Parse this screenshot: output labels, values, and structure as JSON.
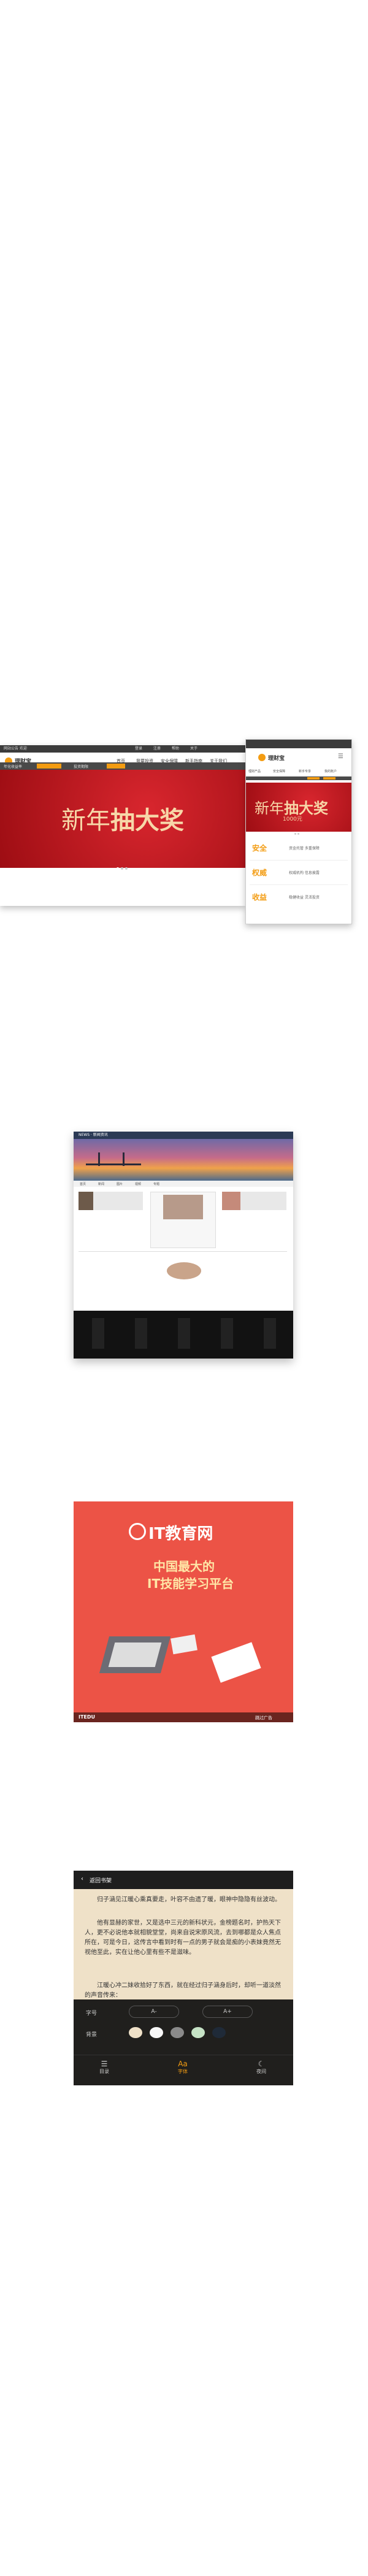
{
  "desktop": {
    "topbar_left": "网站公告 欢迎",
    "topbar_links": [
      "登录",
      "注册",
      "帮助",
      "关于"
    ],
    "logo_text": "理财宝",
    "nav_items": [
      "首页",
      "我要投资",
      "安全保障",
      "新手指南",
      "关于我们",
      "我的账户"
    ],
    "filter_labels": [
      "年化收益率",
      "投资期限"
    ],
    "banner_title_small": "新年",
    "banner_title_big": "抽大奖"
  },
  "phone": {
    "logo_text": "理财宝",
    "menu_items": [
      "理财产品",
      "安全保障",
      "新手专享",
      "我的账户"
    ],
    "banner_title_small": "新年",
    "banner_title_big": "抽大奖",
    "banner_sub": "1000元",
    "features": [
      {
        "title": "安全",
        "desc": "资金托管 多重保障"
      },
      {
        "title": "权威",
        "desc": "权威机构 信息披露"
      },
      {
        "title": "收益",
        "desc": "稳健收益 灵活投资"
      }
    ]
  },
  "news": {
    "header": "NEWS · 新闻资讯",
    "nav": [
      "首页",
      "新闻",
      "图片",
      "视频",
      "专题"
    ]
  },
  "it": {
    "logo": "IT教育网",
    "tagline_1": "中国最大的",
    "tagline_2": "IT技能学习平台",
    "footer_left": "ITEDU",
    "footer_right": "跳过广告"
  },
  "reader": {
    "back": "返回书架",
    "paragraphs": [
      "归子涵见江暖心乘真要走，叶容不由遗了暖，眼神中隐隐有丝波动。",
      "他有显赫的家世，又是选中三元的新科状元，金榜题名时，护热天下人，更不必说他本就相貌堂堂，尚来自说宋原风流，去到哪都是众人焦点所在，可是今日，这传言中看到时有一点的男子就会是痴的小表妹竟然无视他至此，实在让他心里有些不是滋味。",
      "江暖心冲二妹收拾好了东西，就在经过归子涵身后时，却听一道淡然的声音传来："
    ],
    "font_label": "字号",
    "font_small": "A-",
    "font_large": "A+",
    "bg_label": "背景",
    "bottom_items": [
      "目录",
      "字体",
      "夜间"
    ],
    "bottom_icons": [
      "list-icon",
      "font-icon",
      "moon-icon"
    ],
    "accent": "#f39c12"
  }
}
